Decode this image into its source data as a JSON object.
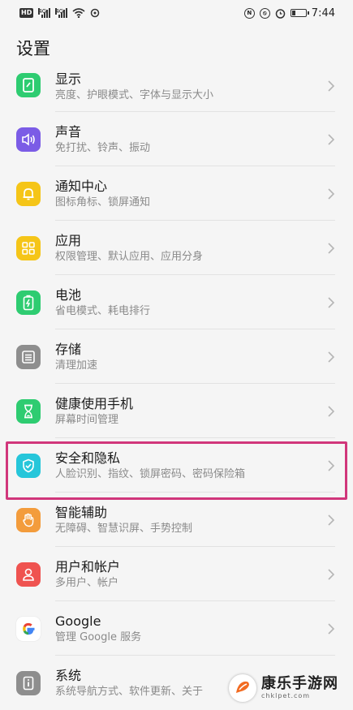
{
  "status_bar": {
    "hd_label": "HD",
    "signal_label": "4G",
    "time": "7:44"
  },
  "page_title": "设置",
  "items": [
    {
      "title": "显示",
      "subtitle": "亮度、护眼模式、字体与显示大小",
      "color": "#2ecc71",
      "icon": "display-icon"
    },
    {
      "title": "声音",
      "subtitle": "免打扰、铃声、振动",
      "color": "#7b5ce6",
      "icon": "speaker-icon"
    },
    {
      "title": "通知中心",
      "subtitle": "图标角标、锁屏通知",
      "color": "#f5c518",
      "icon": "bell-icon"
    },
    {
      "title": "应用",
      "subtitle": "权限管理、默认应用、应用分身",
      "color": "#f5c518",
      "icon": "apps-grid-icon"
    },
    {
      "title": "电池",
      "subtitle": "省电模式、耗电排行",
      "color": "#2ecc71",
      "icon": "battery-icon"
    },
    {
      "title": "存储",
      "subtitle": "清理加速",
      "color": "#8e8e8e",
      "icon": "storage-icon"
    },
    {
      "title": "健康使用手机",
      "subtitle": "屏幕时间管理",
      "color": "#2ecc71",
      "icon": "hourglass-icon"
    },
    {
      "title": "安全和隐私",
      "subtitle": "人脸识别、指纹、锁屏密码、密码保险箱",
      "color": "#26c6da",
      "icon": "shield-icon"
    },
    {
      "title": "智能辅助",
      "subtitle": "无障碍、智慧识屏、手势控制",
      "color": "#f39c3c",
      "icon": "hand-icon"
    },
    {
      "title": "用户和帐户",
      "subtitle": "多用户、帐户",
      "color": "#ef5350",
      "icon": "user-icon"
    },
    {
      "title": "Google",
      "subtitle": "管理 Google 服务",
      "color": "#ffffff",
      "icon": "google-icon"
    },
    {
      "title": "系统",
      "subtitle": "系统导航方式、软件更新、关于",
      "color": "#8e8e8e",
      "icon": "info-icon"
    }
  ],
  "watermark": {
    "title": "康乐手游网",
    "url": "chklpet.com"
  }
}
